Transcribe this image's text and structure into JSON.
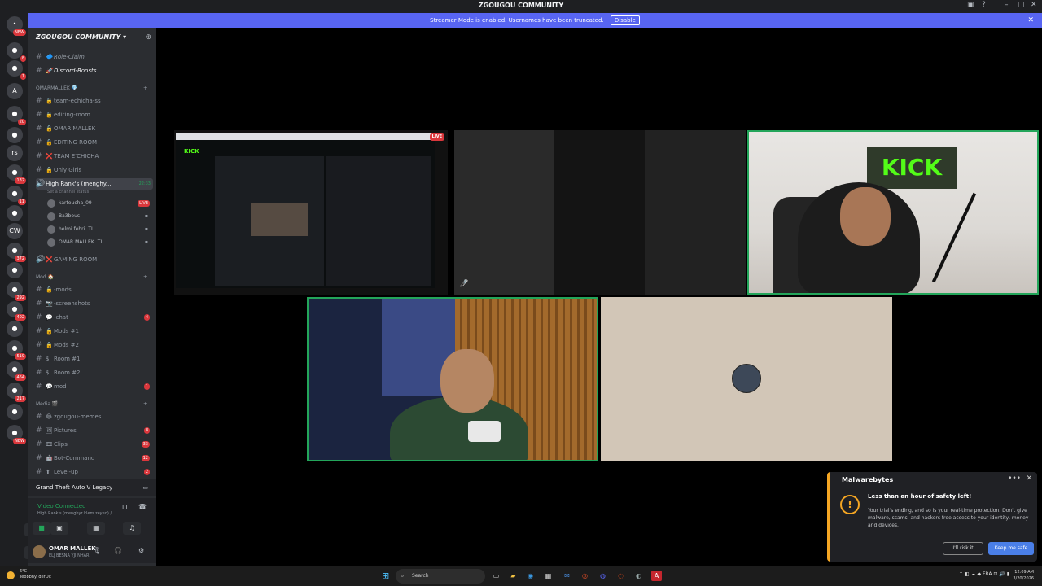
{
  "window": {
    "title": "ZGOUGOU COMMUNITY"
  },
  "banner": {
    "text": "Streamer Mode is enabled. Usernames have been truncated.",
    "disable_label": "Disable"
  },
  "server_rail": {
    "items": [
      {
        "glyph": "•",
        "badge": "NEW"
      },
      {
        "glyph": "●",
        "badge": "8"
      },
      {
        "glyph": "●",
        "badge": "1"
      },
      {
        "glyph": "A",
        "badge": ""
      },
      {
        "glyph": "●",
        "badge": "20"
      },
      {
        "glyph": "●",
        "badge": ""
      },
      {
        "glyph": "rs",
        "badge": ""
      },
      {
        "glyph": "●",
        "badge": "132"
      },
      {
        "glyph": "●",
        "badge": "11"
      },
      {
        "glyph": "●",
        "badge": ""
      },
      {
        "glyph": "CW",
        "badge": ""
      },
      {
        "glyph": "●",
        "badge": "372"
      },
      {
        "glyph": "●",
        "badge": ""
      },
      {
        "glyph": "●",
        "badge": "292"
      },
      {
        "glyph": "●",
        "badge": "402"
      },
      {
        "glyph": "●",
        "badge": ""
      },
      {
        "glyph": "●",
        "badge": "519"
      },
      {
        "glyph": "●",
        "badge": "464"
      },
      {
        "glyph": "●",
        "badge": "217"
      },
      {
        "glyph": "●",
        "badge": ""
      },
      {
        "glyph": "●",
        "badge": "NEW"
      }
    ]
  },
  "guild": {
    "name": "ZGOUGOU COMMUNITY"
  },
  "channels": [
    {
      "name": "Role-Claim",
      "emoji": "🔷",
      "count": ""
    },
    {
      "name": "Discord-Boosts",
      "emoji": "🚀",
      "count": ""
    }
  ],
  "categories": {
    "omar": "OMARMALLEK 💎",
    "mod": "Mod 🏠",
    "media": "Media 🎬"
  },
  "omar_channels": [
    {
      "name": "team-echicha-ss",
      "emoji": "🔒",
      "count": ""
    },
    {
      "name": "editing-room",
      "emoji": "🔒",
      "count": ""
    },
    {
      "name": "OMAR MALLEK",
      "emoji": "🔒",
      "count": ""
    },
    {
      "name": "EDITING ROOM",
      "emoji": "🔒",
      "count": ""
    },
    {
      "name": "TEAM E'CHICHA",
      "emoji": "❌",
      "count": ""
    },
    {
      "name": "Only Girls",
      "emoji": "🔒",
      "count": ""
    }
  ],
  "voice_channel": {
    "name": "High Rank's (menghy...",
    "time": "22:33",
    "status": "Set a channel status"
  },
  "voice_users": [
    {
      "name": "kartoucha_09",
      "tag": "",
      "live": "LIVE"
    },
    {
      "name": "Ba3bous",
      "tag": "",
      "live": ""
    },
    {
      "name": "helmi fehri",
      "tag": "TL",
      "live": ""
    },
    {
      "name": "OMAR MALLEK",
      "tag": "TL",
      "live": ""
    }
  ],
  "gaming_room": {
    "name": "GAMING ROOM",
    "emoji": "❌"
  },
  "mod_channels": [
    {
      "name": "-mods",
      "emoji": "🔒",
      "count": ""
    },
    {
      "name": "-screenshots",
      "emoji": "📷",
      "count": ""
    },
    {
      "name": "-chat",
      "emoji": "💬",
      "count": "4"
    },
    {
      "name": "Mods #1",
      "emoji": "🔒",
      "count": ""
    },
    {
      "name": "Mods #2",
      "emoji": "🔒",
      "count": ""
    },
    {
      "name": "Room #1",
      "emoji": "$",
      "count": ""
    },
    {
      "name": "Room #2",
      "emoji": "$",
      "count": ""
    },
    {
      "name": "mod",
      "emoji": "💬",
      "count": "1"
    }
  ],
  "media_channels": [
    {
      "name": "zgougou-memes",
      "emoji": "😂",
      "count": ""
    },
    {
      "name": "Pictures",
      "emoji": "🖼",
      "count": "8"
    },
    {
      "name": "Clips",
      "emoji": "🎞",
      "count": "33"
    },
    {
      "name": "Bot-Command",
      "emoji": "🤖",
      "count": "12"
    },
    {
      "name": "Level-up",
      "emoji": "⬆",
      "count": "2"
    }
  ],
  "activity": {
    "game": "Grand Theft Auto V Legacy"
  },
  "voice_panel": {
    "title": "Video Connected",
    "subtitle": "High Rank's (menghyr klem zeyed) / ..."
  },
  "user": {
    "name": "OMAR MALLEK",
    "status": "ELJ BESNA YJI NHAR"
  },
  "stage": {
    "live_label": "LIVE",
    "kick_logo": "KICK",
    "sign_text": "KICK"
  },
  "toast": {
    "brand": "Malwarebytes",
    "heading": "Less than an hour of safety left!",
    "body": "Your trial's ending, and so is your real-time protection. Don't give malware, scams, and hackers free access to your identity, money and devices.",
    "risk_label": "I'll risk it",
    "safe_label": "Keep me safe"
  },
  "taskbar": {
    "weather_temp": "6°C",
    "weather_desc": "Tebbbny. derOlt",
    "search_placeholder": "Search",
    "lang": "FRA",
    "time": "12:09 AM",
    "date": "3/20/2026"
  }
}
